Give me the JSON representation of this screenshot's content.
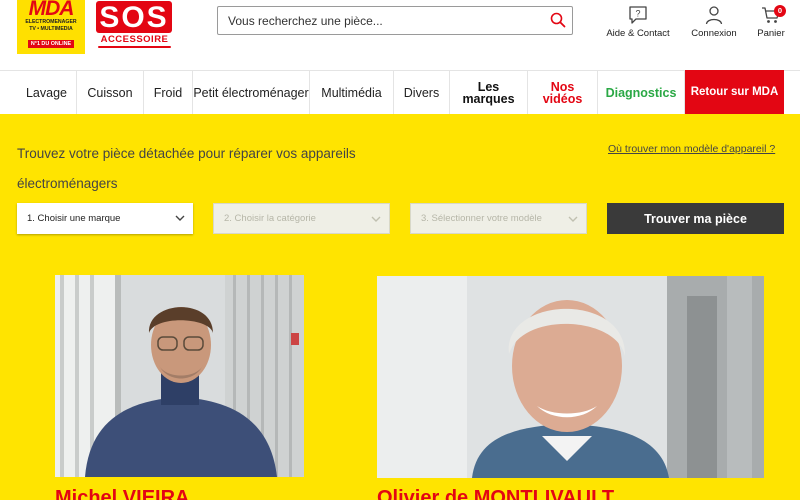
{
  "header": {
    "mda_logo": {
      "name": "MDA",
      "line1": "ELECTROMENAGER",
      "line2": "TV • MULTIMEDIA",
      "badge": "N°1 DU ONLINE"
    },
    "sos_logo": {
      "name": "SOS",
      "subtitle": "ACCESSOIRE"
    },
    "search": {
      "placeholder": "Vous recherchez une pièce..."
    },
    "links": {
      "help": "Aide & Contact",
      "login": "Connexion",
      "cart": "Panier"
    },
    "cart_count": "0"
  },
  "nav": {
    "items": [
      {
        "label": "Lavage"
      },
      {
        "label": "Cuisson"
      },
      {
        "label": "Froid"
      },
      {
        "label": "Petit électroménager"
      },
      {
        "label": "Multimédia"
      },
      {
        "label": "Divers"
      },
      {
        "label": "Les marques"
      },
      {
        "label": "Nos vidéos"
      },
      {
        "label": "Diagnostics"
      },
      {
        "label": "Retour sur MDA"
      }
    ]
  },
  "finder": {
    "title": "Trouvez votre pièce détachée pour réparer vos appareils électroménagers",
    "help_link": "Où trouver mon modèle d'appareil ?",
    "brand_select": "1. Choisir une marque",
    "category_select": "2. Choisir la catégorie",
    "model_select": "3. Sélectionner votre modèle",
    "button": "Trouver ma pièce"
  },
  "people": [
    {
      "name": "Michel VIEIRA"
    },
    {
      "name": "Olivier de MONTLIVAULT"
    }
  ],
  "colors": {
    "brand_red": "#e30613",
    "yellow": "#ffe400",
    "green": "#2aa845",
    "dark_button": "#3a3a3a"
  }
}
